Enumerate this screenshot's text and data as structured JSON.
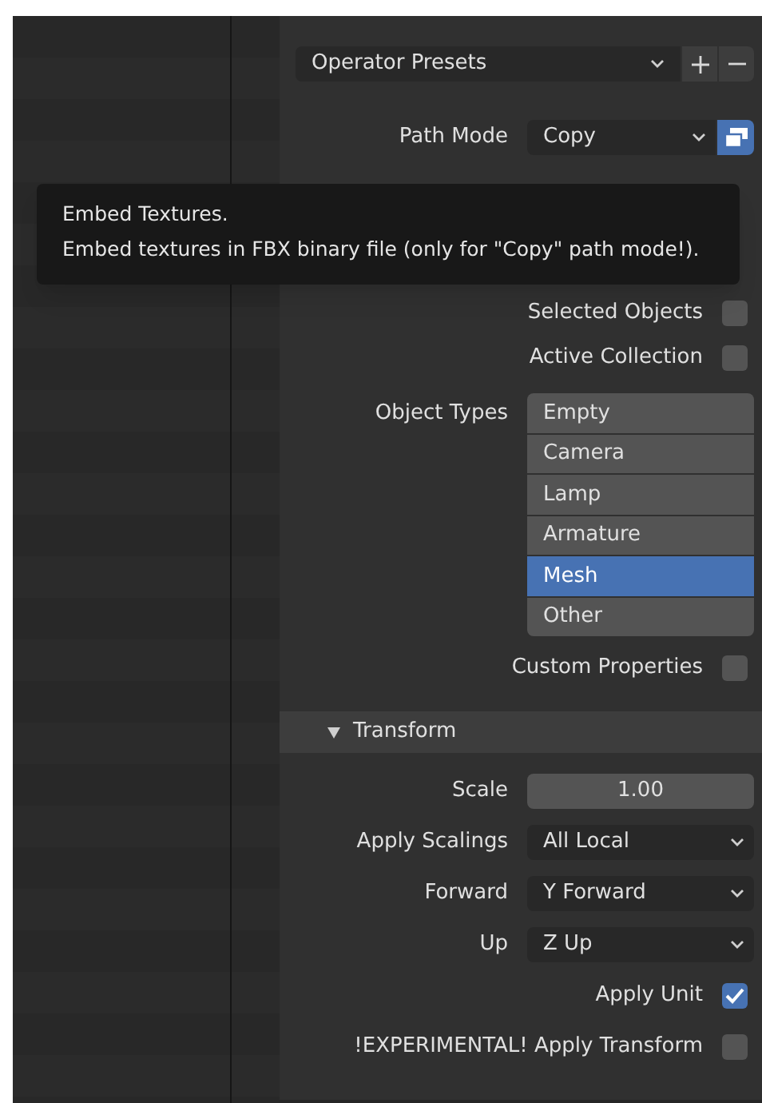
{
  "presets": {
    "label": "Operator Presets"
  },
  "path_mode": {
    "label": "Path Mode",
    "value": "Copy",
    "embed_textures_on": true
  },
  "include": [
    {
      "label": "Selected Objects",
      "checked": false
    },
    {
      "label": "Active Collection",
      "checked": false
    }
  ],
  "object_types": {
    "label": "Object Types",
    "items": [
      {
        "label": "Empty",
        "selected": false
      },
      {
        "label": "Camera",
        "selected": false
      },
      {
        "label": "Lamp",
        "selected": false
      },
      {
        "label": "Armature",
        "selected": false
      },
      {
        "label": "Mesh",
        "selected": true
      },
      {
        "label": "Other",
        "selected": false
      }
    ]
  },
  "custom_properties": {
    "label": "Custom Properties",
    "checked": false
  },
  "transform": {
    "title": "Transform",
    "expanded": true,
    "rows": [
      {
        "kind": "number",
        "label": "Scale",
        "value": "1.00"
      },
      {
        "kind": "dropdown",
        "label": "Apply Scalings",
        "value": "All Local"
      },
      {
        "kind": "dropdown",
        "label": "Forward",
        "value": "Y Forward"
      },
      {
        "kind": "dropdown",
        "label": "Up",
        "value": "Z Up"
      },
      {
        "kind": "checkbox",
        "label": "Apply Unit",
        "checked": true
      },
      {
        "kind": "checkbox",
        "label": "!EXPERIMENTAL! Apply Transform",
        "checked": false
      }
    ]
  },
  "tooltip": {
    "lines": [
      "Embed Textures.",
      "Embed textures in FBX binary file (only for \"Copy\" path mode!)."
    ]
  }
}
